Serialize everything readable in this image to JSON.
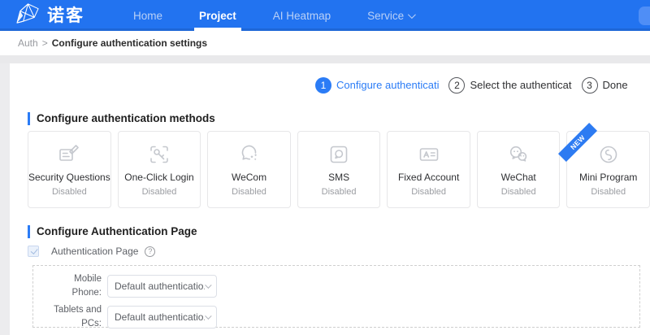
{
  "nav": {
    "brand": "诺客",
    "items": [
      {
        "label": "Home",
        "active": false
      },
      {
        "label": "Project",
        "active": true
      },
      {
        "label": "AI Heatmap",
        "active": false
      },
      {
        "label": "Service",
        "active": false,
        "has_caret": true
      }
    ]
  },
  "breadcrumb": {
    "parent": "Auth",
    "separator": ">",
    "current": "Configure authentication settings"
  },
  "stepper": {
    "steps": [
      {
        "number": "1",
        "label": "Configure authenticati",
        "active": true
      },
      {
        "number": "2",
        "label": "Select the authenticat",
        "active": false
      },
      {
        "number": "3",
        "label": "Done",
        "active": false
      }
    ]
  },
  "methods": {
    "title": "Configure authentication methods",
    "cards": [
      {
        "name": "Security Questions",
        "status": "Disabled",
        "icon": "security-questions-icon"
      },
      {
        "name": "One-Click Login",
        "status": "Disabled",
        "icon": "one-click-login-icon"
      },
      {
        "name": "WeCom",
        "status": "Disabled",
        "icon": "wecom-icon"
      },
      {
        "name": "SMS",
        "status": "Disabled",
        "icon": "sms-icon"
      },
      {
        "name": "Fixed Account",
        "status": "Disabled",
        "icon": "fixed-account-icon"
      },
      {
        "name": "WeChat",
        "status": "Disabled",
        "icon": "wechat-icon"
      },
      {
        "name": "Mini Program",
        "status": "Disabled",
        "icon": "mini-program-icon",
        "badge": "NEW"
      }
    ]
  },
  "auth_page": {
    "title": "Configure Authentication Page",
    "checkbox_label": "Authentication Page",
    "checkbox_checked": true,
    "help_glyph": "?",
    "rows": [
      {
        "label": "Mobile Phone:",
        "value": "Default authenticatio..."
      },
      {
        "label": "Tablets and PCs:",
        "value": "Default authenticatio..."
      }
    ]
  },
  "colors": {
    "nav_blue": "#2273f0",
    "accent_blue": "#2b7cf6",
    "inactive_nav_text": "#b9d0f7",
    "icon_gray": "#c5c8ce",
    "disabled_text": "#9b9da2",
    "band_gray": "#e9e9eb"
  }
}
